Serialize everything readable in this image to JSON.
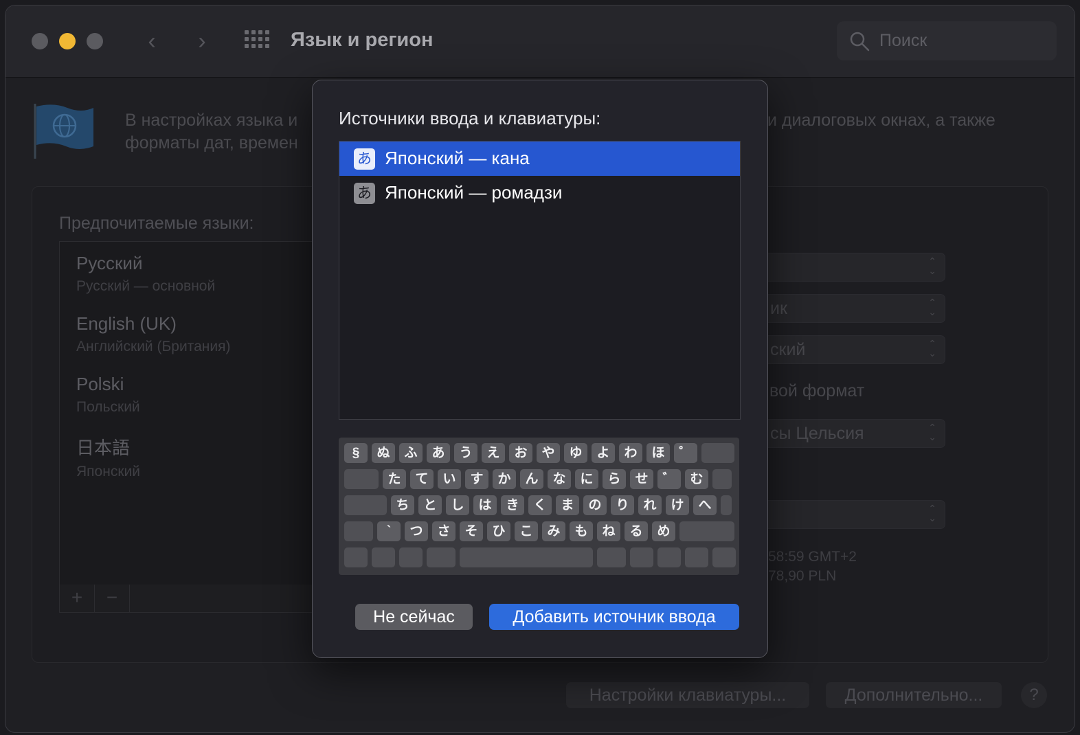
{
  "window": {
    "title": "Язык и регион"
  },
  "search": {
    "placeholder": "Поиск"
  },
  "pane": {
    "description_line1_left": "В настройках языка и",
    "description_line1_right": "и диалоговых окнах, а также",
    "description_line2_left": "форматы дат, времен",
    "preferred_label": "Предпочитаемые языки:",
    "languages": [
      {
        "name": "Русский",
        "sub": "Русский — основной"
      },
      {
        "name": "English (UK)",
        "sub": "Английский (Британия)"
      },
      {
        "name": "Polski",
        "sub": "Польский"
      },
      {
        "name": "日本語",
        "sub": "Японский"
      }
    ],
    "add_symbol": "+",
    "remove_symbol": "−",
    "popups": [
      "",
      "ик",
      "ский",
      "сы Цельсия",
      ""
    ],
    "format_text": "вой формат",
    "sample_time": "58:59 GMT+2",
    "sample_number": "78,90 PLN",
    "keyboard_settings_button": "Настройки клавиатуры...",
    "advanced_button": "Дополнительно...",
    "help": "?"
  },
  "sheet": {
    "title": "Источники ввода и клавиатуры:",
    "sources": [
      {
        "icon": "あ",
        "label": "Японский — кана",
        "selected": true
      },
      {
        "icon": "あ",
        "label": "Японский — ромадзи",
        "selected": false
      }
    ],
    "keyboard_rows": [
      [
        "§",
        "ぬ",
        "ふ",
        "あ",
        "う",
        "え",
        "お",
        "や",
        "ゆ",
        "よ",
        "わ",
        "ほ",
        "゜"
      ],
      [
        "た",
        "て",
        "い",
        "す",
        "か",
        "ん",
        "な",
        "に",
        "ら",
        "せ",
        "゛",
        "む"
      ],
      [
        "ち",
        "と",
        "し",
        "は",
        "き",
        "く",
        "ま",
        "の",
        "り",
        "れ",
        "け",
        "へ"
      ],
      [
        "`",
        "つ",
        "さ",
        "そ",
        "ひ",
        "こ",
        "み",
        "も",
        "ね",
        "る",
        "め"
      ]
    ],
    "cancel_button": "Не сейчас",
    "add_button": "Добавить источник ввода"
  },
  "colors": {
    "accent": "#2657d0",
    "button_blue": "#2d6bdc",
    "minimize": "#f1b834"
  },
  "icons": {
    "nav_back": "‹",
    "nav_forward": "›"
  }
}
